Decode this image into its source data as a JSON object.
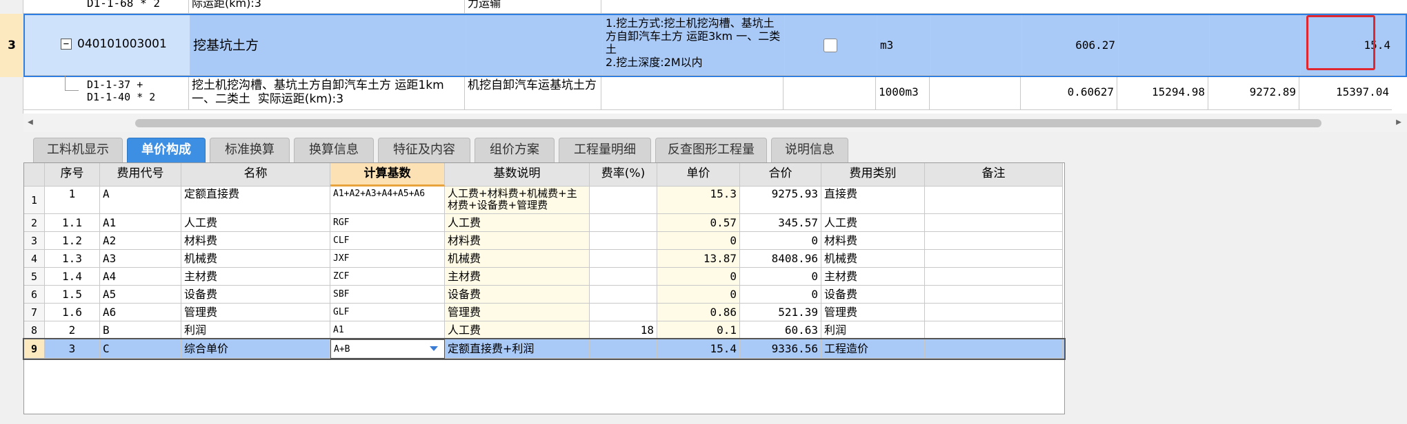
{
  "top_grid": {
    "row_prev": {
      "code": "D1-1-68 * 2",
      "name": "际运距(km):3",
      "desc": "力运输"
    },
    "row_main": {
      "num": "3",
      "code": "040101003001",
      "name": "挖基坑土方",
      "feature": "1.挖土方式:挖土机挖沟槽、基坑土方自卸汽车土方 运距3km 一、二类土\n2.挖土深度:2M以内",
      "unit": "m3",
      "qty": "606.27",
      "total": "15.4"
    },
    "row_sub": {
      "code": "D1-1-37 +\nD1-1-40 * 2",
      "name": "挖土机挖沟槽、基坑土方自卸汽车土方 运距1km 一、二类土  实际运距(km):3",
      "desc": "机挖自卸汽车运基坑土方",
      "unit": "1000m3",
      "qty": "0.60627",
      "v1": "15294.98",
      "v2": "9272.89",
      "v3": "15397.04"
    }
  },
  "scrollbar": {
    "left_arrow": "◀",
    "right_arrow": "▶"
  },
  "tabs": [
    "工料机显示",
    "单价构成",
    "标准换算",
    "换算信息",
    "特征及内容",
    "组价方案",
    "工程量明细",
    "反查图形工程量",
    "说明信息"
  ],
  "active_tab": "单价构成",
  "price_table": {
    "headers": [
      "序号",
      "费用代号",
      "名称",
      "计算基数",
      "基数说明",
      "费率(%)",
      "单价",
      "合价",
      "费用类别",
      "备注"
    ],
    "rows": [
      {
        "n": "1",
        "seq": "1",
        "code": "A",
        "name": "定额直接费",
        "base": "A1+A2+A3+A4+A5+A6",
        "desc": "人工费+材料费+机械费+主材费+设备费+管理费",
        "rate": "",
        "price": "15.3",
        "amount": "9275.93",
        "cat": "直接费",
        "note": ""
      },
      {
        "n": "2",
        "seq": "1.1",
        "code": "A1",
        "name": "人工费",
        "base": "RGF",
        "desc": "人工费",
        "rate": "",
        "price": "0.57",
        "amount": "345.57",
        "cat": "人工费",
        "note": ""
      },
      {
        "n": "3",
        "seq": "1.2",
        "code": "A2",
        "name": "材料费",
        "base": "CLF",
        "desc": "材料费",
        "rate": "",
        "price": "0",
        "amount": "0",
        "cat": "材料费",
        "note": ""
      },
      {
        "n": "4",
        "seq": "1.3",
        "code": "A3",
        "name": "机械费",
        "base": "JXF",
        "desc": "机械费",
        "rate": "",
        "price": "13.87",
        "amount": "8408.96",
        "cat": "机械费",
        "note": ""
      },
      {
        "n": "5",
        "seq": "1.4",
        "code": "A4",
        "name": "主材费",
        "base": "ZCF",
        "desc": "主材费",
        "rate": "",
        "price": "0",
        "amount": "0",
        "cat": "主材费",
        "note": ""
      },
      {
        "n": "6",
        "seq": "1.5",
        "code": "A5",
        "name": "设备费",
        "base": "SBF",
        "desc": "设备费",
        "rate": "",
        "price": "0",
        "amount": "0",
        "cat": "设备费",
        "note": ""
      },
      {
        "n": "7",
        "seq": "1.6",
        "code": "A6",
        "name": "管理费",
        "base": "GLF",
        "desc": "管理费",
        "rate": "",
        "price": "0.86",
        "amount": "521.39",
        "cat": "管理费",
        "note": ""
      },
      {
        "n": "8",
        "seq": "2",
        "code": "B",
        "name": "利润",
        "base": "A1",
        "desc": "人工费",
        "rate": "18",
        "price": "0.1",
        "amount": "60.63",
        "cat": "利润",
        "note": ""
      },
      {
        "n": "9",
        "seq": "3",
        "code": "C",
        "name": "综合单价",
        "base": "A+B",
        "desc": "定额直接费+利润",
        "rate": "",
        "price": "15.4",
        "amount": "9336.56",
        "cat": "工程造价",
        "note": ""
      }
    ]
  },
  "colors": {
    "selected_row": "#a9c9f7",
    "tab_active": "#3d8fe3",
    "highlight_box": "#e0262e",
    "yellow_col": "#fffbe6"
  }
}
